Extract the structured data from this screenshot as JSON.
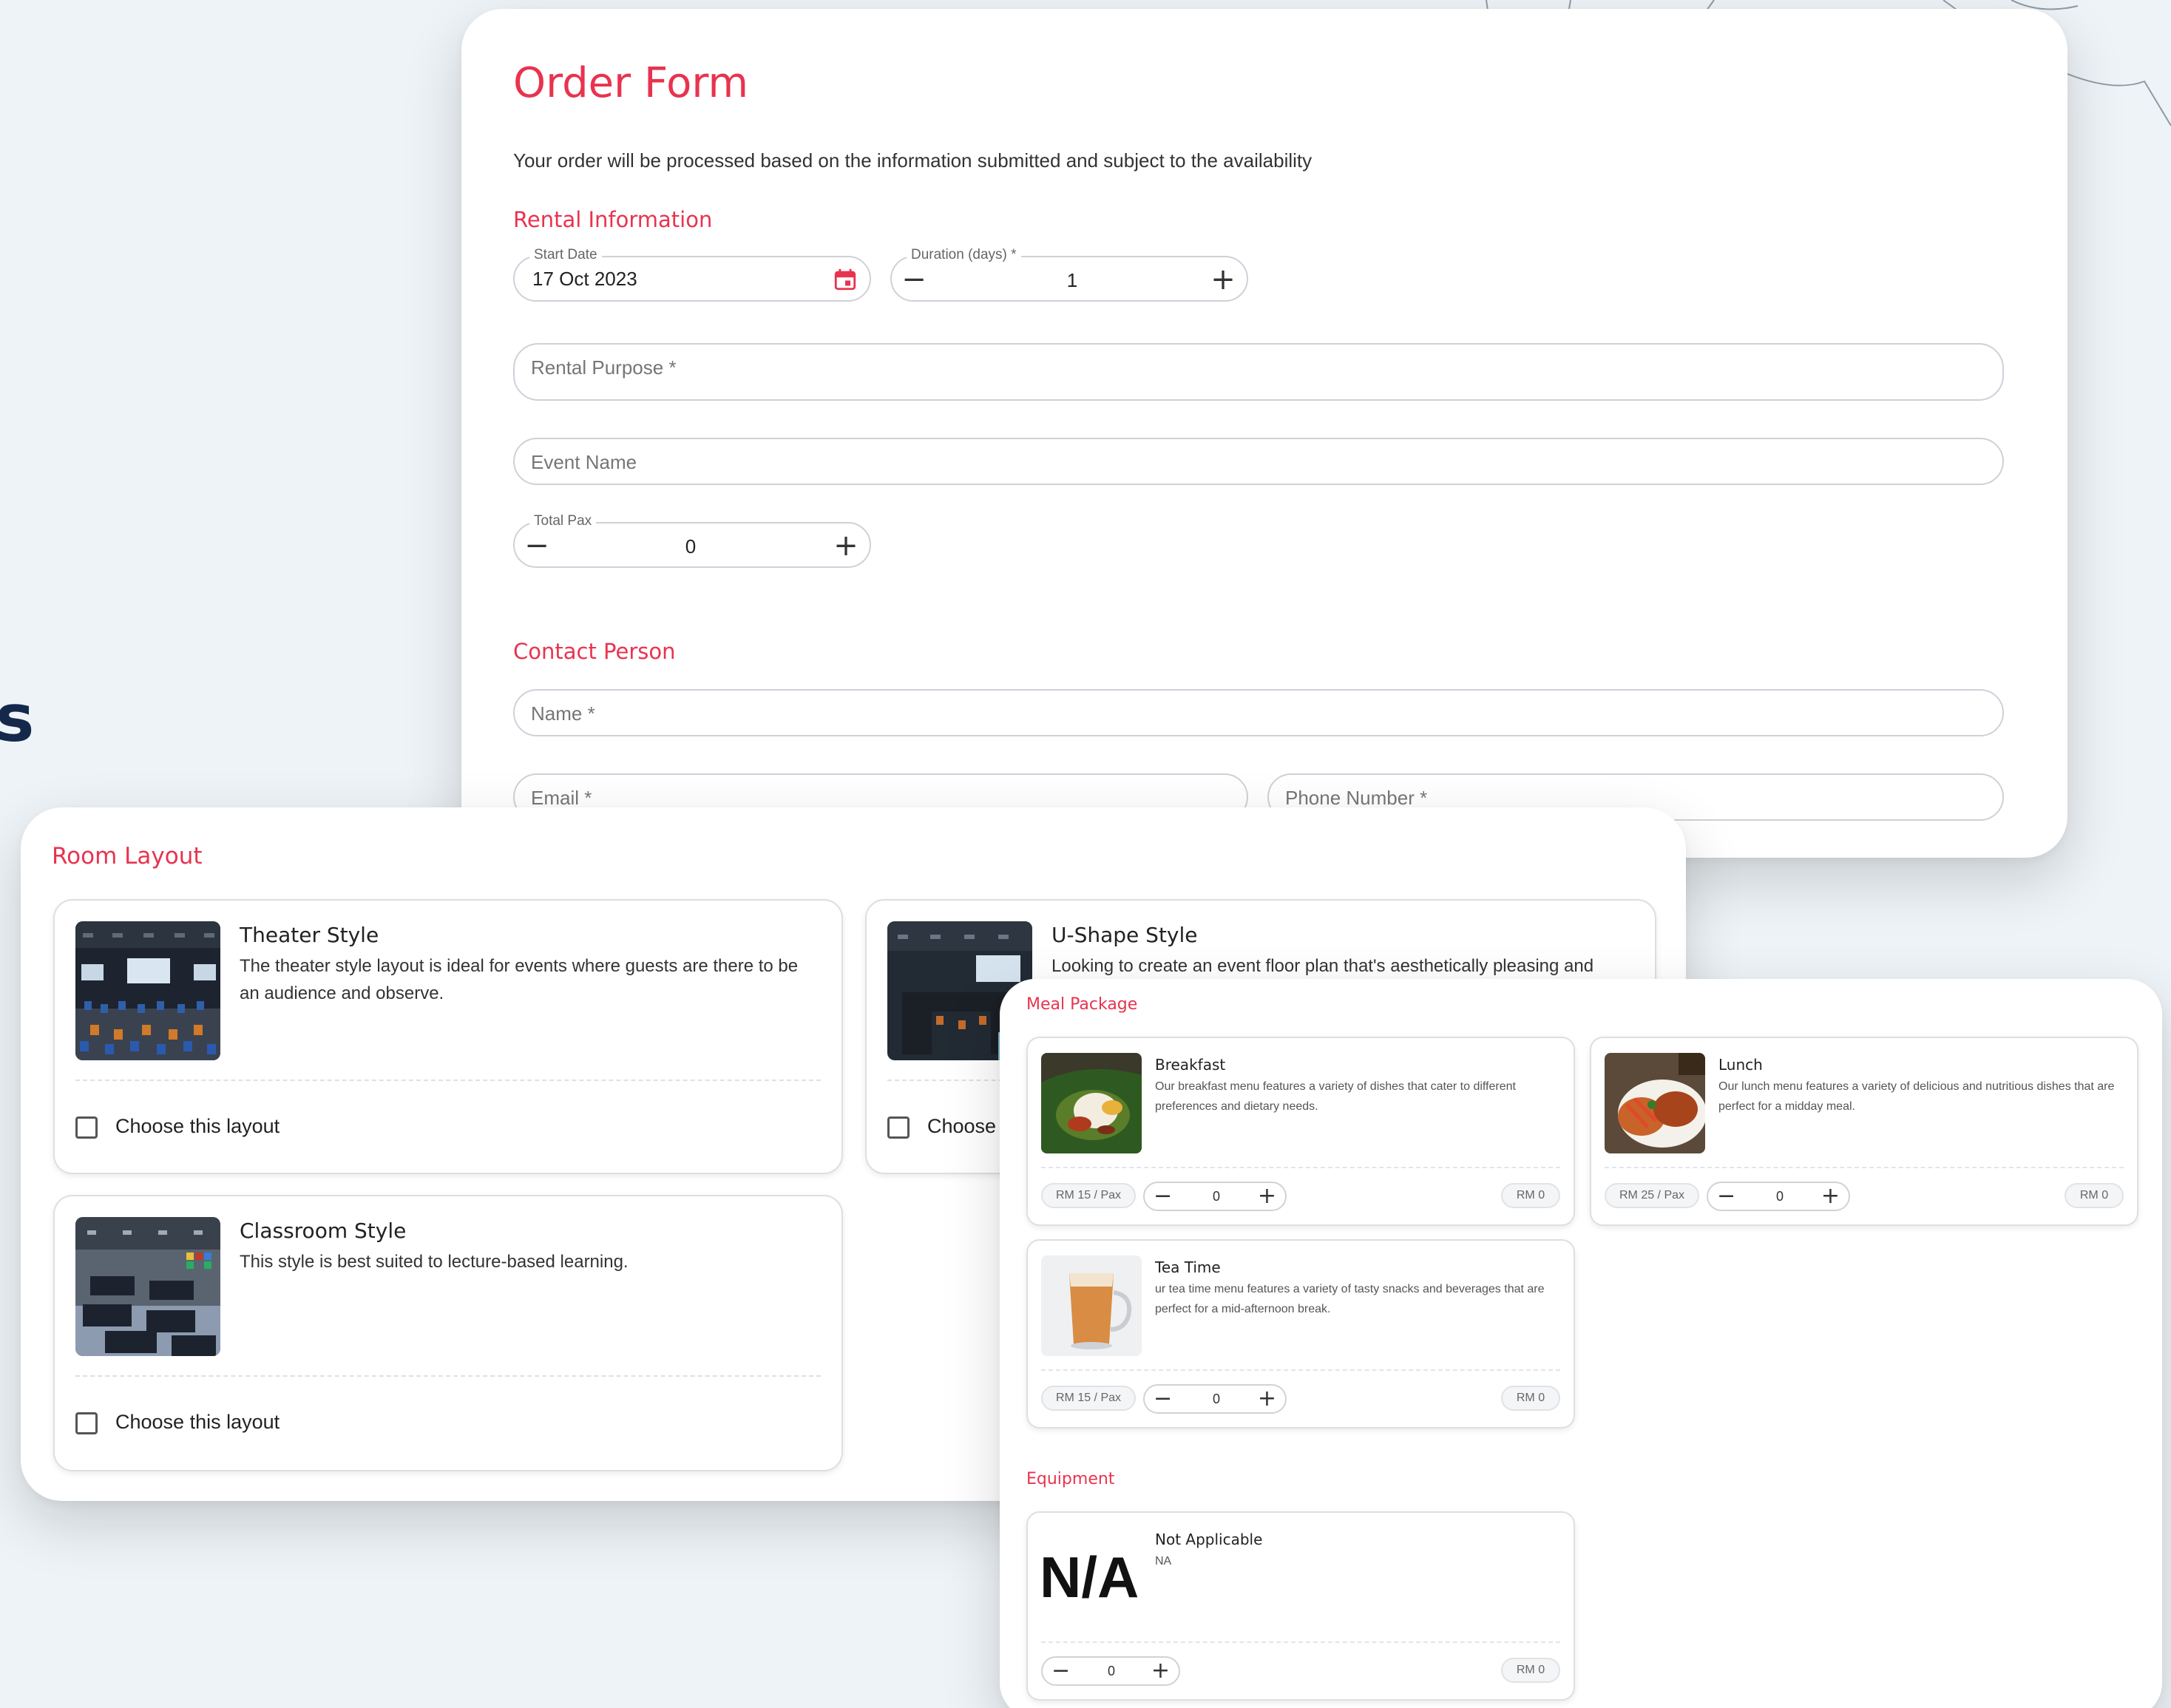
{
  "background": {
    "partial_heading": "s"
  },
  "order_form": {
    "title": "Order Form",
    "intro": "Your order will be processed based on the information submitted and subject to the availability",
    "rental_section": "Rental Information",
    "start_date_label": "Start Date",
    "start_date_value": "17 Oct 2023",
    "duration_label": "Duration (days) *",
    "duration_value": "1",
    "rental_purpose_placeholder": "Rental Purpose *",
    "event_name_placeholder": "Event Name",
    "total_pax_label": "Total Pax",
    "total_pax_value": "0",
    "contact_section": "Contact Person",
    "name_placeholder": "Name *",
    "email_placeholder": "Email *",
    "phone_placeholder": "Phone Number *"
  },
  "room_layout": {
    "title": "Room Layout",
    "layouts": [
      {
        "title": "Theater Style",
        "description": "The theater style layout is ideal for events where guests are there to be an audience and observe.",
        "choose_label": "Choose this layout"
      },
      {
        "title": "U-Shape Style",
        "description": "Looking to create an event floor plan that's aesthetically pleasing and",
        "choose_label": "Choose"
      },
      {
        "title": "Classroom Style",
        "description": "This style is best suited to lecture-based learning.",
        "choose_label": "Choose this layout"
      }
    ]
  },
  "meal_package": {
    "title": "Meal Package",
    "items": [
      {
        "title": "Breakfast",
        "description": "Our breakfast menu features a variety of dishes that cater to different preferences and dietary needs.",
        "price": "RM 15 / Pax",
        "quantity": "0",
        "total": "RM 0"
      },
      {
        "title": "Lunch",
        "description": "Our lunch menu features a variety of delicious and nutritious dishes that are perfect for a midday meal.",
        "price": "RM 25 / Pax",
        "quantity": "0",
        "total": "RM 0"
      },
      {
        "title": "Tea Time",
        "description": "ur tea time menu features a variety of tasty snacks and beverages that are perfect for a mid-afternoon break.",
        "price": "RM 15 / Pax",
        "quantity": "0",
        "total": "RM 0"
      }
    ]
  },
  "equipment": {
    "title": "Equipment",
    "items": [
      {
        "logo_text": "N/A",
        "title": "Not Applicable",
        "description": "NA",
        "quantity": "0",
        "total": "RM 0"
      }
    ]
  },
  "icons": {
    "calendar": "calendar-icon",
    "minus": "minus-icon",
    "plus": "plus-icon",
    "checkbox": "checkbox-icon"
  },
  "colors": {
    "accent": "#e8334f",
    "background": "#eef3f7",
    "card": "#ffffff",
    "border": "#cdd2d8",
    "navy_text": "#14284b"
  }
}
